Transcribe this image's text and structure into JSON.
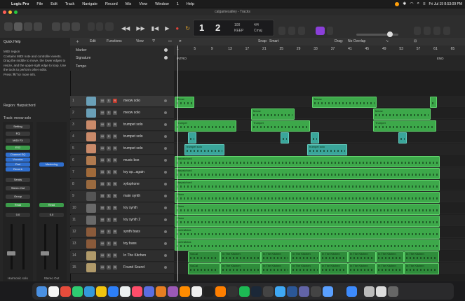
{
  "menubar": {
    "apple": "",
    "items": [
      "Logic Pro",
      "File",
      "Edit",
      "Track",
      "Navigate",
      "Record",
      "Mix",
      "View",
      "Window",
      "1",
      "Help"
    ],
    "datetime": "Fri Jul 19 8:53:09 PM"
  },
  "window": {
    "title": "calgamesalley - Tracks"
  },
  "lcd": {
    "bar": "1",
    "beat": "2",
    "tempo": "100",
    "tempo_label": "KEEP",
    "signature": "4/4",
    "key": "Cmaj"
  },
  "quick_help": {
    "title": "Quick Help",
    "text": "MIDI region\nContains MIDI note and controller events. Drag the middle to move, the lower edges to resize, and the upper-right edge to loop. Use the tools to perform other edits.\nPress ⌘/ for more info."
  },
  "inspector": {
    "region_label": "Region: Harpsichord",
    "track_label": "Track: meow solo",
    "left_strip": {
      "setting": "Setting",
      "eq": "EQ",
      "midi_fx": "MIDI FX",
      "plugins": [
        "ES2",
        "Channel EQ",
        "Vocoder",
        "Pad",
        "Reverb"
      ],
      "sends": "Sends",
      "output": "Stereo Out",
      "group": "Group",
      "automation": "Read",
      "volume": "0.0",
      "pan": "0.0",
      "label": "Harmonic solo"
    },
    "right_strip": {
      "plugins": [
        "Mastering"
      ],
      "automation": "Read",
      "volume": "0.0",
      "label": "Stereo Out"
    }
  },
  "toolbar": {
    "edit": "Edit",
    "functions": "Functions",
    "view": "View",
    "snap_label": "Snap:",
    "snap_value": "Smart",
    "drag_label": "Drag:",
    "drag_value": "No Overlap"
  },
  "global_tracks": {
    "marker": "Marker",
    "signature": "Signature",
    "tempo": "Tempo"
  },
  "ruler": {
    "bars": [
      "1",
      "5",
      "9",
      "13",
      "17",
      "21",
      "25",
      "29",
      "33",
      "37",
      "41",
      "45",
      "49",
      "53",
      "57",
      "61",
      "65"
    ],
    "intro": "INTRO",
    "end": "END"
  },
  "tracks": [
    {
      "num": "1",
      "name": "meow solo"
    },
    {
      "num": "2",
      "name": "meow solo"
    },
    {
      "num": "3",
      "name": "trumpet solo"
    },
    {
      "num": "4",
      "name": "trumpet solo"
    },
    {
      "num": "5",
      "name": "trumpet solo"
    },
    {
      "num": "6",
      "name": "music box"
    },
    {
      "num": "7",
      "name": "toy sp...again"
    },
    {
      "num": "8",
      "name": "xylophone"
    },
    {
      "num": "9",
      "name": "main synth"
    },
    {
      "num": "10",
      "name": "toy synth"
    },
    {
      "num": "11",
      "name": "toy synth 2"
    },
    {
      "num": "12",
      "name": "synth bass"
    },
    {
      "num": "13",
      "name": "toy bass"
    },
    {
      "num": "14",
      "name": "In The Kitchen"
    },
    {
      "num": "15",
      "name": "Found Sound"
    }
  ],
  "regions": {
    "meow": "Meow",
    "trumpet": "Trumpet",
    "trumpet_solo": "trumpet solo",
    "harpsichord": "Harpsichord",
    "piano": "Piano",
    "contrabass": "Contrabass",
    "kitchen": "In The Kitchen",
    "soul": "SoCal"
  },
  "colors": {
    "region_green": "#3da84a",
    "region_teal": "#3aa59a",
    "record": "#e0443a",
    "accent_purple": "#8b3fd9"
  }
}
